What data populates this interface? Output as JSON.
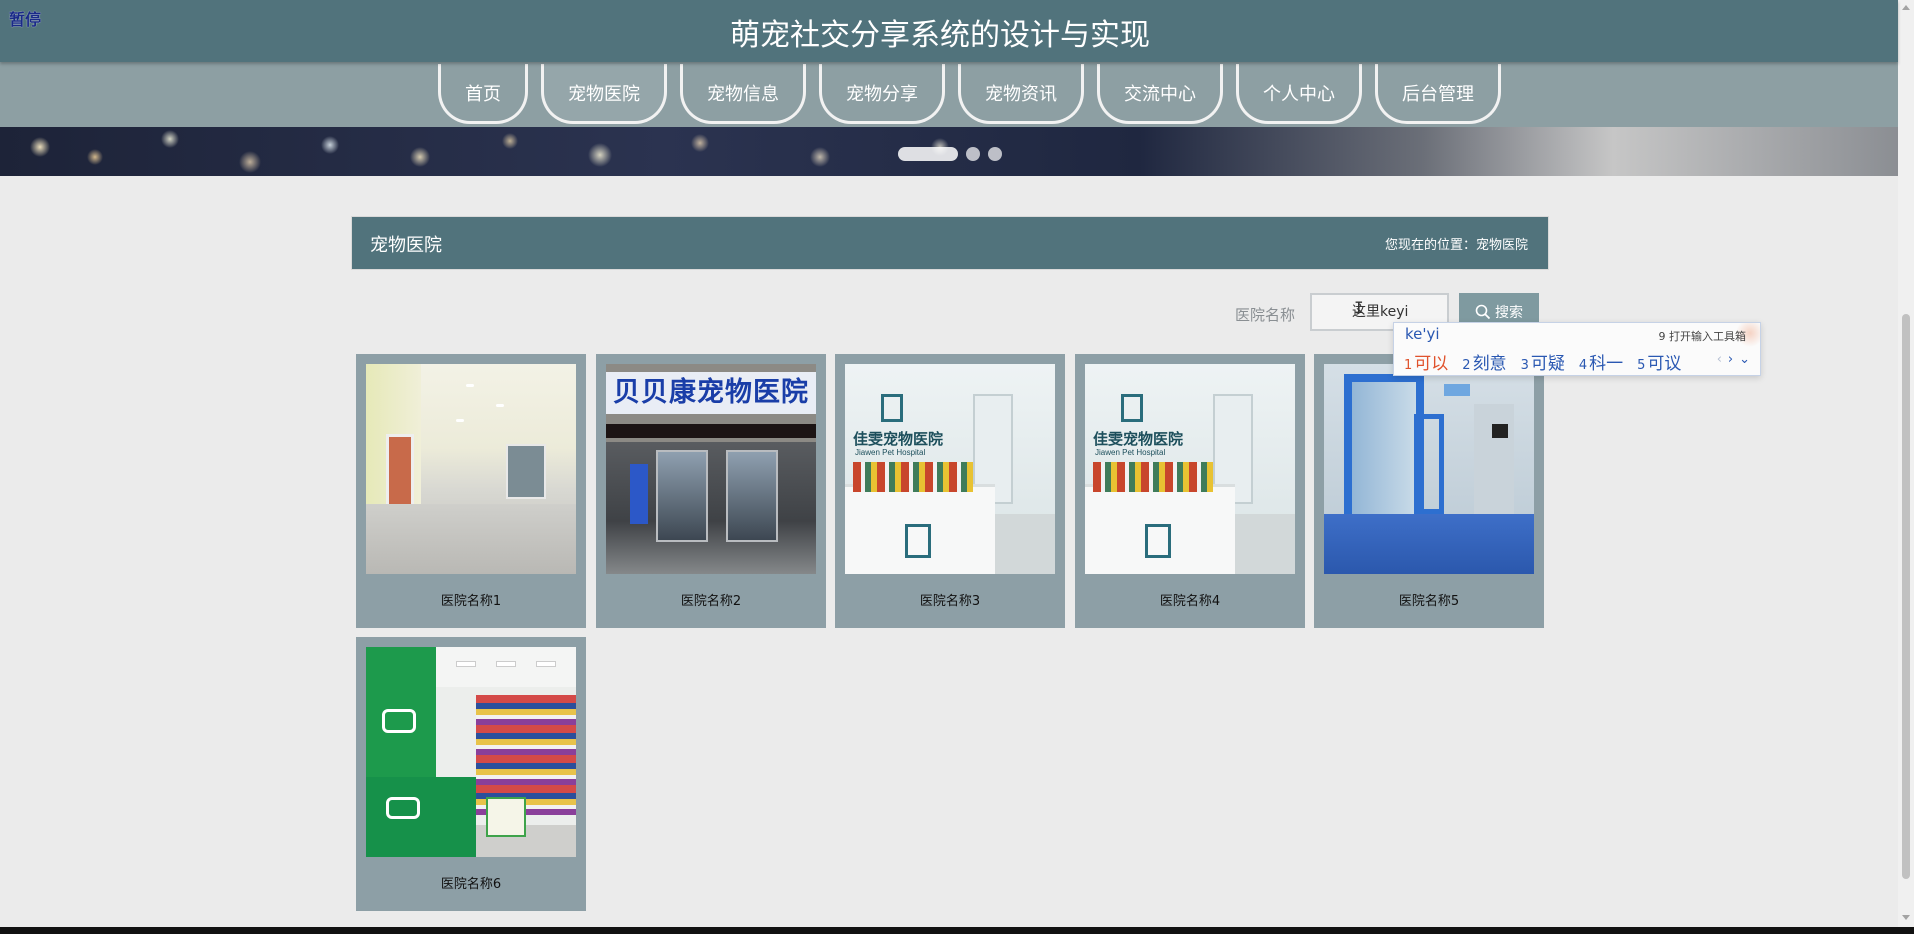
{
  "header": {
    "pause_label": "暂停",
    "site_title": "萌宠社交分享系统的设计与实现"
  },
  "nav": {
    "items": [
      {
        "label": "首页"
      },
      {
        "label": "宠物医院",
        "active": true
      },
      {
        "label": "宠物信息"
      },
      {
        "label": "宠物分享"
      },
      {
        "label": "宠物资讯"
      },
      {
        "label": "交流中心"
      },
      {
        "label": "个人中心"
      },
      {
        "label": "后台管理"
      }
    ]
  },
  "banner": {
    "slide_count": 3,
    "active_slide": 1
  },
  "section": {
    "title": "宠物医院",
    "breadcrumb": "您现在的位置：宠物医院"
  },
  "search": {
    "label": "医院名称",
    "value": "这里keyi",
    "button_label": "搜索"
  },
  "ime": {
    "pinyin": "ke'yi",
    "toolbox": "9 打开输入工具箱",
    "candidates": [
      {
        "num": "1",
        "text": "可以"
      },
      {
        "num": "2",
        "text": "刻意"
      },
      {
        "num": "3",
        "text": "可疑"
      },
      {
        "num": "4",
        "text": "科一"
      },
      {
        "num": "5",
        "text": "可议"
      }
    ]
  },
  "hospitals": [
    {
      "name": "医院名称1",
      "photo": "hospital-corridor"
    },
    {
      "name": "医院名称2",
      "photo": "storefront",
      "sign_text": "贝贝康宠物医院"
    },
    {
      "name": "医院名称3",
      "photo": "reception",
      "logo_text": "佳雯宠物医院",
      "logo_sub": "Jiawen Pet Hospital"
    },
    {
      "name": "医院名称4",
      "photo": "reception",
      "logo_text": "佳雯宠物医院",
      "logo_sub": "Jiawen Pet Hospital"
    },
    {
      "name": "医院名称5",
      "photo": "blue-corridor"
    },
    {
      "name": "医院名称6",
      "photo": "green-shop"
    }
  ],
  "colors": {
    "header_bg": "#51737c",
    "nav_bg": "#8d9fa3",
    "card_bg": "#8d9fa6",
    "page_bg": "#ebebeb",
    "ime_candidate": "#2a58b2",
    "ime_first": "#e0522c"
  }
}
